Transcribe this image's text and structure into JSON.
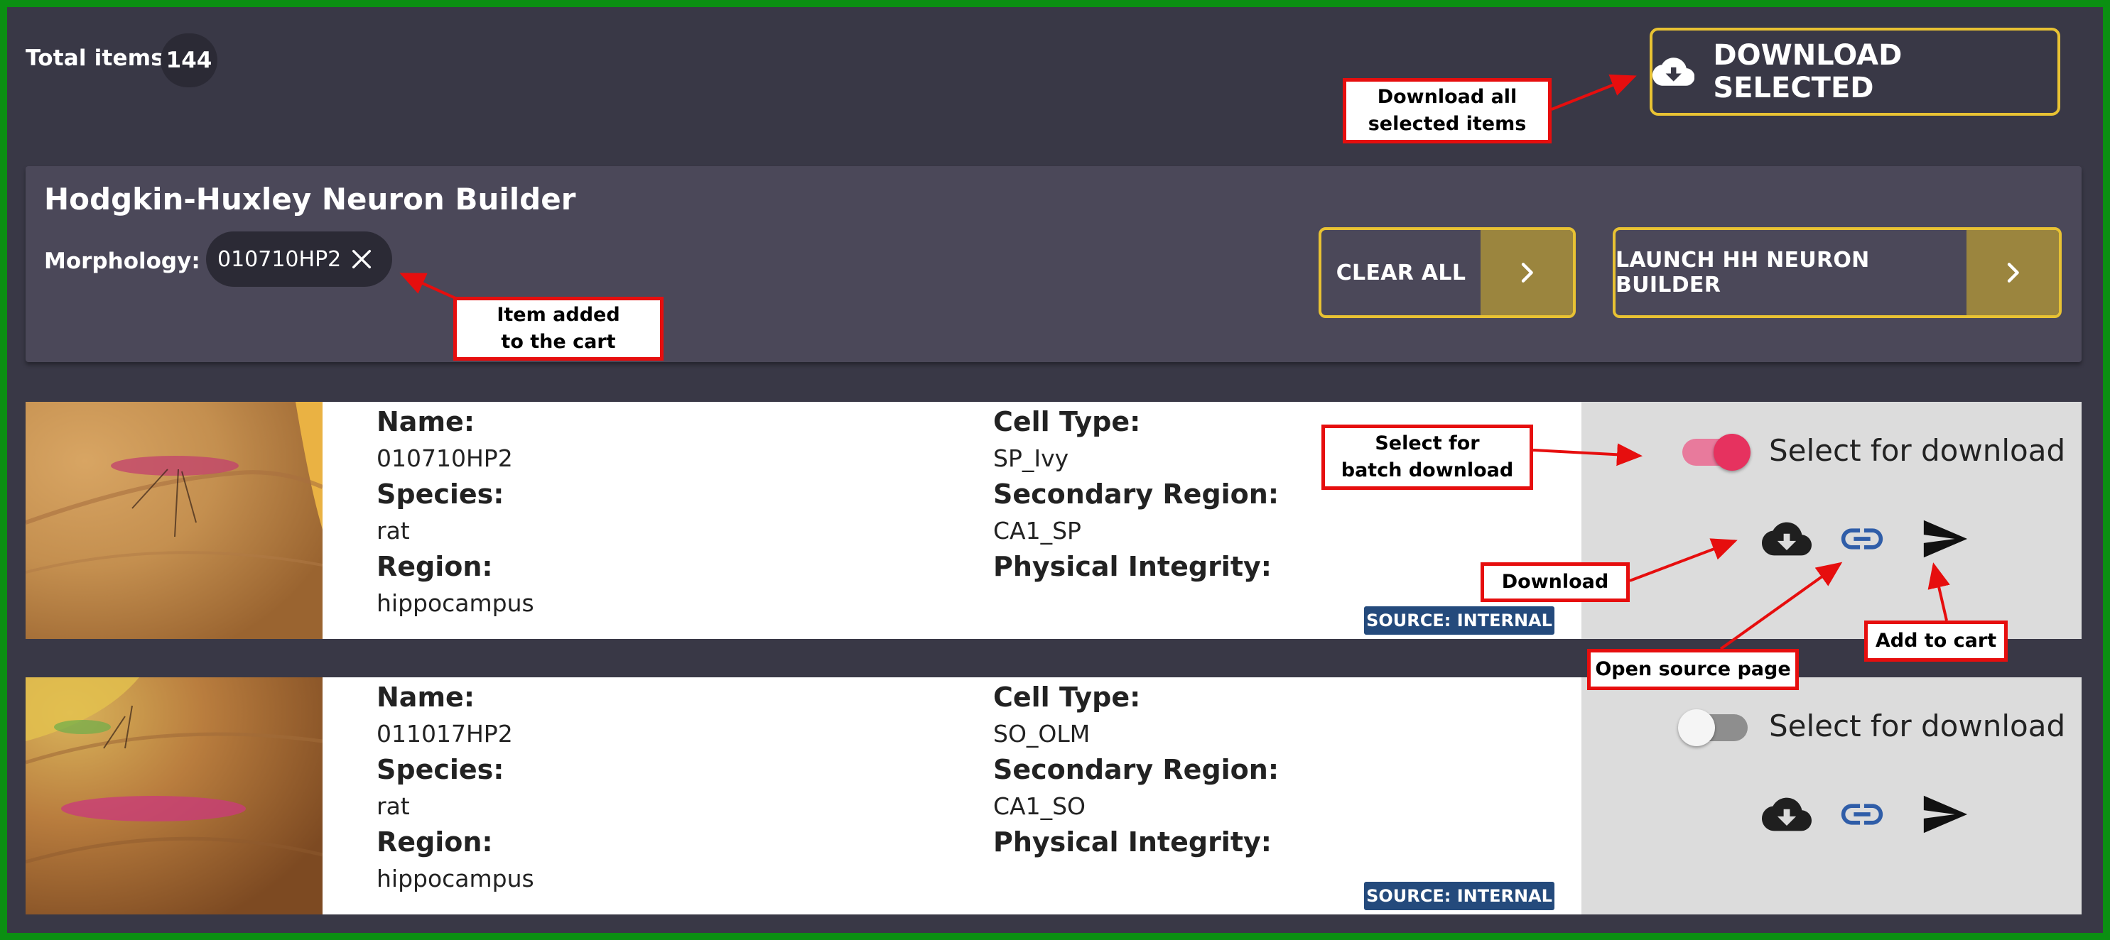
{
  "header": {
    "total_label": "Total items",
    "total_count": "144",
    "download_selected_label": "DOWNLOAD SELECTED"
  },
  "builder": {
    "title": "Hodgkin-Huxley Neuron Builder",
    "morphology_label": "Morphology:",
    "morphology_chip": "010710HP2",
    "clear_all_label": "CLEAR ALL",
    "launch_label": "LAUNCH HH NEURON BUILDER"
  },
  "cards": [
    {
      "name_label": "Name:",
      "name": "010710HP2",
      "species_label": "Species:",
      "species": "rat",
      "region_label": "Region:",
      "region": "hippocampus",
      "cell_type_label": "Cell Type:",
      "cell_type": "SP_Ivy",
      "secondary_region_label": "Secondary Region:",
      "secondary_region": "CA1_SP",
      "physical_integrity_label": "Physical Integrity:",
      "source_badge": "SOURCE: INTERNAL",
      "select_label": "Select for download",
      "selected": true
    },
    {
      "name_label": "Name:",
      "name": "011017HP2",
      "species_label": "Species:",
      "species": "rat",
      "region_label": "Region:",
      "region": "hippocampus",
      "cell_type_label": "Cell Type:",
      "cell_type": "SO_OLM",
      "secondary_region_label": "Secondary Region:",
      "secondary_region": "CA1_SO",
      "physical_integrity_label": "Physical Integrity:",
      "source_badge": "SOURCE: INTERNAL",
      "select_label": "Select for download",
      "selected": false
    }
  ],
  "annotations": {
    "download_all_line1": "Download all",
    "download_all_line2": "selected items",
    "item_added_line1": "Item added",
    "item_added_line2": "to the cart",
    "select_batch_line1": "Select for",
    "select_batch_line2": "batch download",
    "download": "Download",
    "open_source": "Open source page",
    "add_to_cart": "Add to cart"
  },
  "colors": {
    "background": "#393846",
    "panel": "#4b4859",
    "accent_border": "#e8c233",
    "accent_fill": "#9b853e",
    "toggle_on": "#e6325f",
    "source_badge": "#244a7c",
    "annotation_red": "#e60e0e",
    "frame_green": "#0b8f12"
  },
  "icons": [
    "cloud-download-icon",
    "chevron-right-icon",
    "close-icon",
    "link-icon",
    "send-icon"
  ]
}
